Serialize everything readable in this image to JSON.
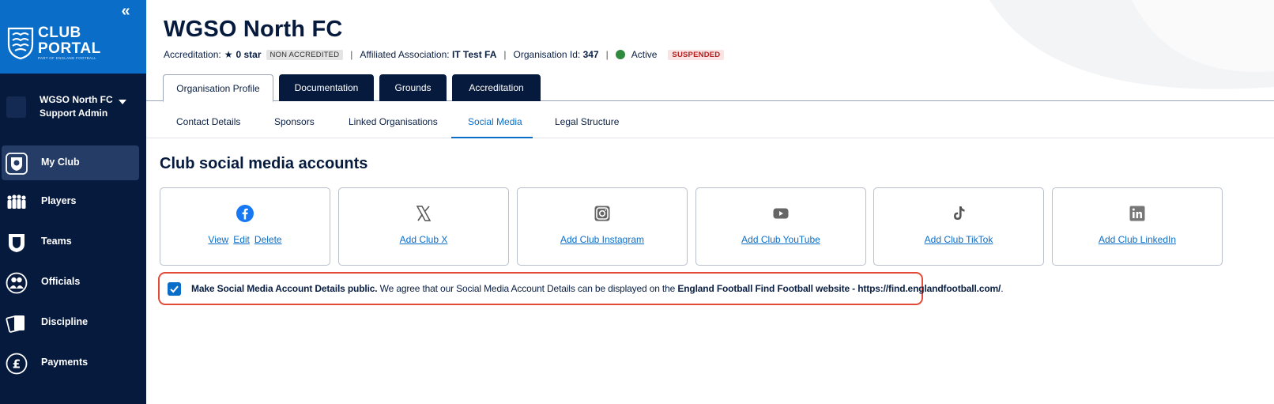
{
  "sidebar": {
    "collapse_label": "«",
    "brand": {
      "line1": "CLUB",
      "line2": "PORTAL",
      "tagline": "PART OF ENGLAND FOOTBALL",
      "logo_icon": "england-football-crest-icon"
    },
    "account": {
      "name": "WGSO North FC",
      "role": "Support Admin"
    },
    "nav": [
      {
        "label": "My Club",
        "icon": "club-badge-icon",
        "active": true
      },
      {
        "label": "Players",
        "icon": "players-icon"
      },
      {
        "label": "Teams",
        "icon": "teams-shirt-icon"
      },
      {
        "label": "Officials",
        "icon": "officials-icon"
      },
      {
        "label": "Discipline",
        "icon": "discipline-cards-icon"
      },
      {
        "label": "Payments",
        "icon": "pound-icon"
      }
    ]
  },
  "header": {
    "title": "WGSO North FC",
    "accreditation_label": "Accreditation:",
    "accreditation_value": "0 star",
    "accreditation_badge": "NON ACCREDITED",
    "association_label": "Affiliated Association:",
    "association_value": "IT Test FA",
    "org_id_label": "Organisation Id:",
    "org_id_value": "347",
    "status": "Active",
    "status_badge": "SUSPENDED"
  },
  "primary_tabs": [
    {
      "label": "Organisation Profile",
      "active": true
    },
    {
      "label": "Documentation"
    },
    {
      "label": "Grounds"
    },
    {
      "label": "Accreditation"
    }
  ],
  "sub_tabs": [
    {
      "label": "Contact Details"
    },
    {
      "label": "Sponsors"
    },
    {
      "label": "Linked Organisations"
    },
    {
      "label": "Social Media",
      "active": true
    },
    {
      "label": "Legal Structure"
    }
  ],
  "section": {
    "title": "Club social media accounts",
    "cards": [
      {
        "icon": "facebook-icon",
        "links": [
          "View",
          "Edit",
          "Delete"
        ]
      },
      {
        "icon": "x-icon",
        "links": [
          "Add Club X"
        ]
      },
      {
        "icon": "instagram-icon",
        "links": [
          "Add Club Instagram"
        ]
      },
      {
        "icon": "youtube-icon",
        "links": [
          "Add Club YouTube"
        ]
      },
      {
        "icon": "tiktok-icon",
        "links": [
          "Add Club TikTok"
        ]
      },
      {
        "icon": "linkedin-icon",
        "links": [
          "Add Club LinkedIn"
        ]
      }
    ]
  },
  "consent": {
    "checked": true,
    "bold_lead": "Make Social Media Account Details public.",
    "text": " We agree that our Social Media Account Details can be displayed on the ",
    "bold_link": "England Football Find Football website - https://find.englandfootball.com/",
    "tail": "."
  },
  "colors": {
    "sidebar_bg": "#061a3d",
    "brand_blue": "#0a6ec8",
    "active_nav": "#243c66",
    "status_green": "#2e8b3e",
    "suspended_red": "#b41f1f",
    "highlight_border": "#e34a3a"
  }
}
